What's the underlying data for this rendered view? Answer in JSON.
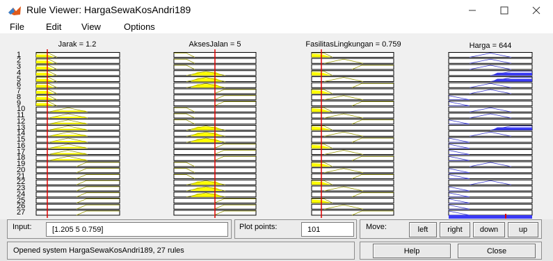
{
  "window": {
    "title": "Rule Viewer: HargaSewaKosAndri189",
    "minimize_icon": "minimize-icon",
    "maximize_icon": "maximize-icon",
    "close_icon": "close-icon"
  },
  "menu": [
    "File",
    "Edit",
    "View",
    "Options"
  ],
  "columns": [
    {
      "title": "Jarak = 1.2",
      "input_value": 1.205
    },
    {
      "title": "AksesJalan = 5",
      "input_value": 5
    },
    {
      "title": "FasilitasLingkungan = 0.759",
      "input_value": 0.759
    },
    {
      "title": "Harga = 644",
      "output_value": 644
    }
  ],
  "rules": [
    "1",
    "2",
    "3",
    "4",
    "5",
    "6",
    "7",
    "8",
    "9",
    "10",
    "11",
    "12",
    "13",
    "14",
    "15",
    "16",
    "17",
    "18",
    "19",
    "20",
    "21",
    "22",
    "23",
    "24",
    "25",
    "26",
    "27"
  ],
  "controls": {
    "input_label": "Input:",
    "input_value": "[1.205 5 0.759]",
    "plot_points_label": "Plot points:",
    "plot_points_value": "101",
    "move_label": "Move:",
    "left": "left",
    "right": "right",
    "down": "down",
    "up": "up",
    "status": "Opened system HargaSewaKosAndri189, 27 rules",
    "help": "Help",
    "close": "Close"
  },
  "colors": {
    "input_fill": "#ffff00",
    "output_fill": "#3b3bf5",
    "marker": "#e00000"
  }
}
